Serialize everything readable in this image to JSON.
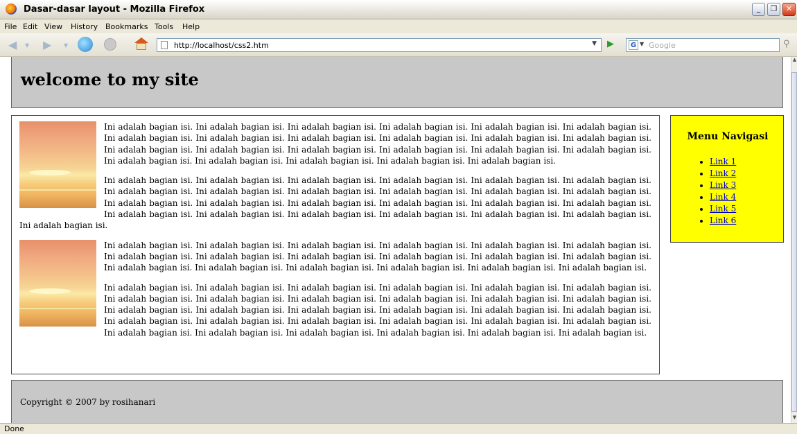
{
  "window": {
    "title": "Dasar-dasar layout - Mozilla Firefox"
  },
  "menu": [
    "File",
    "Edit",
    "View",
    "History",
    "Bookmarks",
    "Tools",
    "Help"
  ],
  "toolbar": {
    "url": "http://localhost/css2.htm",
    "search_placeholder": "Google"
  },
  "page": {
    "header_title": "welcome to my site",
    "paragraphs": [
      "Ini adalah bagian isi. Ini adalah bagian isi. Ini adalah bagian isi. Ini adalah bagian isi. Ini adalah bagian isi. Ini adalah bagian isi. Ini adalah bagian isi. Ini adalah bagian isi. Ini adalah bagian isi. Ini adalah bagian isi. Ini adalah bagian isi. Ini adalah bagian isi. Ini adalah bagian isi. Ini adalah bagian isi. Ini adalah bagian isi. Ini adalah bagian isi. Ini adalah bagian isi. Ini adalah bagian isi. Ini adalah bagian isi. Ini adalah bagian isi. Ini adalah bagian isi. Ini adalah bagian isi. Ini adalah bagian isi.",
      "Ini adalah bagian isi. Ini adalah bagian isi. Ini adalah bagian isi. Ini adalah bagian isi. Ini adalah bagian isi. Ini adalah bagian isi. Ini adalah bagian isi. Ini adalah bagian isi. Ini adalah bagian isi. Ini adalah bagian isi. Ini adalah bagian isi. Ini adalah bagian isi. Ini adalah bagian isi. Ini adalah bagian isi. Ini adalah bagian isi. Ini adalah bagian isi. Ini adalah bagian isi. Ini adalah bagian isi. Ini adalah bagian isi. Ini adalah bagian isi. Ini adalah bagian isi. Ini adalah bagian isi. Ini adalah bagian isi. Ini adalah bagian isi. Ini adalah bagian isi.",
      "Ini adalah bagian isi. Ini adalah bagian isi. Ini adalah bagian isi. Ini adalah bagian isi. Ini adalah bagian isi. Ini adalah bagian isi. Ini adalah bagian isi. Ini adalah bagian isi. Ini adalah bagian isi. Ini adalah bagian isi. Ini adalah bagian isi. Ini adalah bagian isi. Ini adalah bagian isi. Ini adalah bagian isi. Ini adalah bagian isi. Ini adalah bagian isi. Ini adalah bagian isi. Ini adalah bagian isi.",
      "Ini adalah bagian isi. Ini adalah bagian isi. Ini adalah bagian isi. Ini adalah bagian isi. Ini adalah bagian isi. Ini adalah bagian isi. Ini adalah bagian isi. Ini adalah bagian isi. Ini adalah bagian isi. Ini adalah bagian isi. Ini adalah bagian isi. Ini adalah bagian isi. Ini adalah bagian isi. Ini adalah bagian isi. Ini adalah bagian isi. Ini adalah bagian isi. Ini adalah bagian isi. Ini adalah bagian isi. Ini adalah bagian isi. Ini adalah bagian isi. Ini adalah bagian isi. Ini adalah bagian isi. Ini adalah bagian isi. Ini adalah bagian isi. Ini adalah bagian isi. Ini adalah bagian isi. Ini adalah bagian isi. Ini adalah bagian isi. Ini adalah bagian isi. Ini adalah bagian isi."
    ],
    "sidebar": {
      "title": "Menu Navigasi",
      "links": [
        "Link 1",
        "Link 2",
        "Link 3",
        "Link 4",
        "Link 5",
        "Link 6"
      ]
    },
    "footer": "Copyright © 2007 by rosihanari"
  },
  "status": "Done"
}
